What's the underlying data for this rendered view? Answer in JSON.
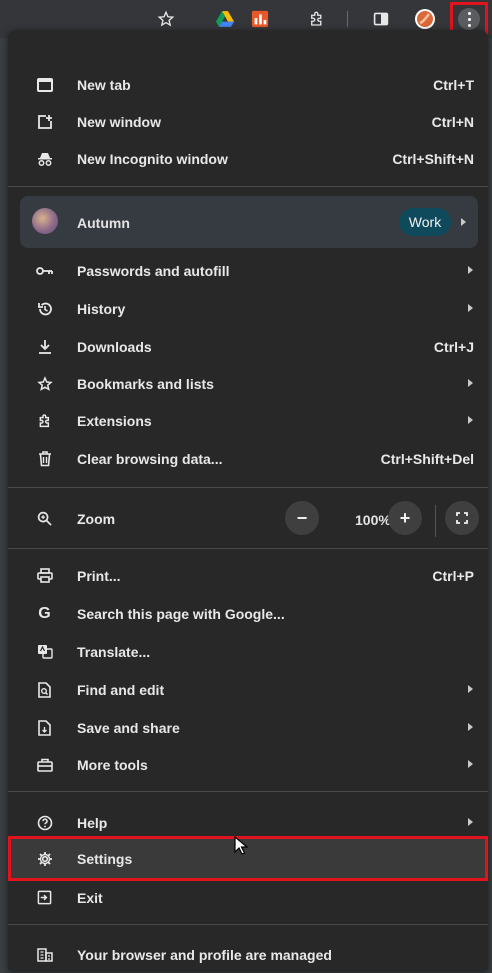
{
  "toolbar": {
    "icons": [
      "star-icon",
      "google-drive-icon",
      "extension-app-icon",
      "puzzle-icon",
      "side-panel-icon",
      "profile-avatar",
      "kebab-menu-icon"
    ]
  },
  "menu": {
    "new_tab": {
      "label": "New tab",
      "shortcut": "Ctrl+T"
    },
    "new_window": {
      "label": "New window",
      "shortcut": "Ctrl+N"
    },
    "new_incognito": {
      "label": "New Incognito window",
      "shortcut": "Ctrl+Shift+N"
    },
    "profile": {
      "name": "Autumn",
      "badge": "Work"
    },
    "passwords": {
      "label": "Passwords and autofill"
    },
    "history": {
      "label": "History"
    },
    "downloads": {
      "label": "Downloads",
      "shortcut": "Ctrl+J"
    },
    "bookmarks": {
      "label": "Bookmarks and lists"
    },
    "extensions": {
      "label": "Extensions"
    },
    "clear_data": {
      "label": "Clear browsing data...",
      "shortcut": "Ctrl+Shift+Del"
    },
    "zoom": {
      "label": "Zoom",
      "minus": "−",
      "value": "100%",
      "plus": "+"
    },
    "print": {
      "label": "Print...",
      "shortcut": "Ctrl+P"
    },
    "search_google": {
      "label": "Search this page with Google..."
    },
    "translate": {
      "label": "Translate..."
    },
    "find_edit": {
      "label": "Find and edit"
    },
    "save_share": {
      "label": "Save and share"
    },
    "more_tools": {
      "label": "More tools"
    },
    "help": {
      "label": "Help"
    },
    "settings": {
      "label": "Settings"
    },
    "exit": {
      "label": "Exit"
    },
    "managed": {
      "label": "Your browser and profile are managed"
    }
  },
  "colors": {
    "highlight": "#e0141c",
    "menu_bg": "#282828",
    "profile_bg": "#353b40",
    "badge_bg": "#0f4a5c"
  }
}
